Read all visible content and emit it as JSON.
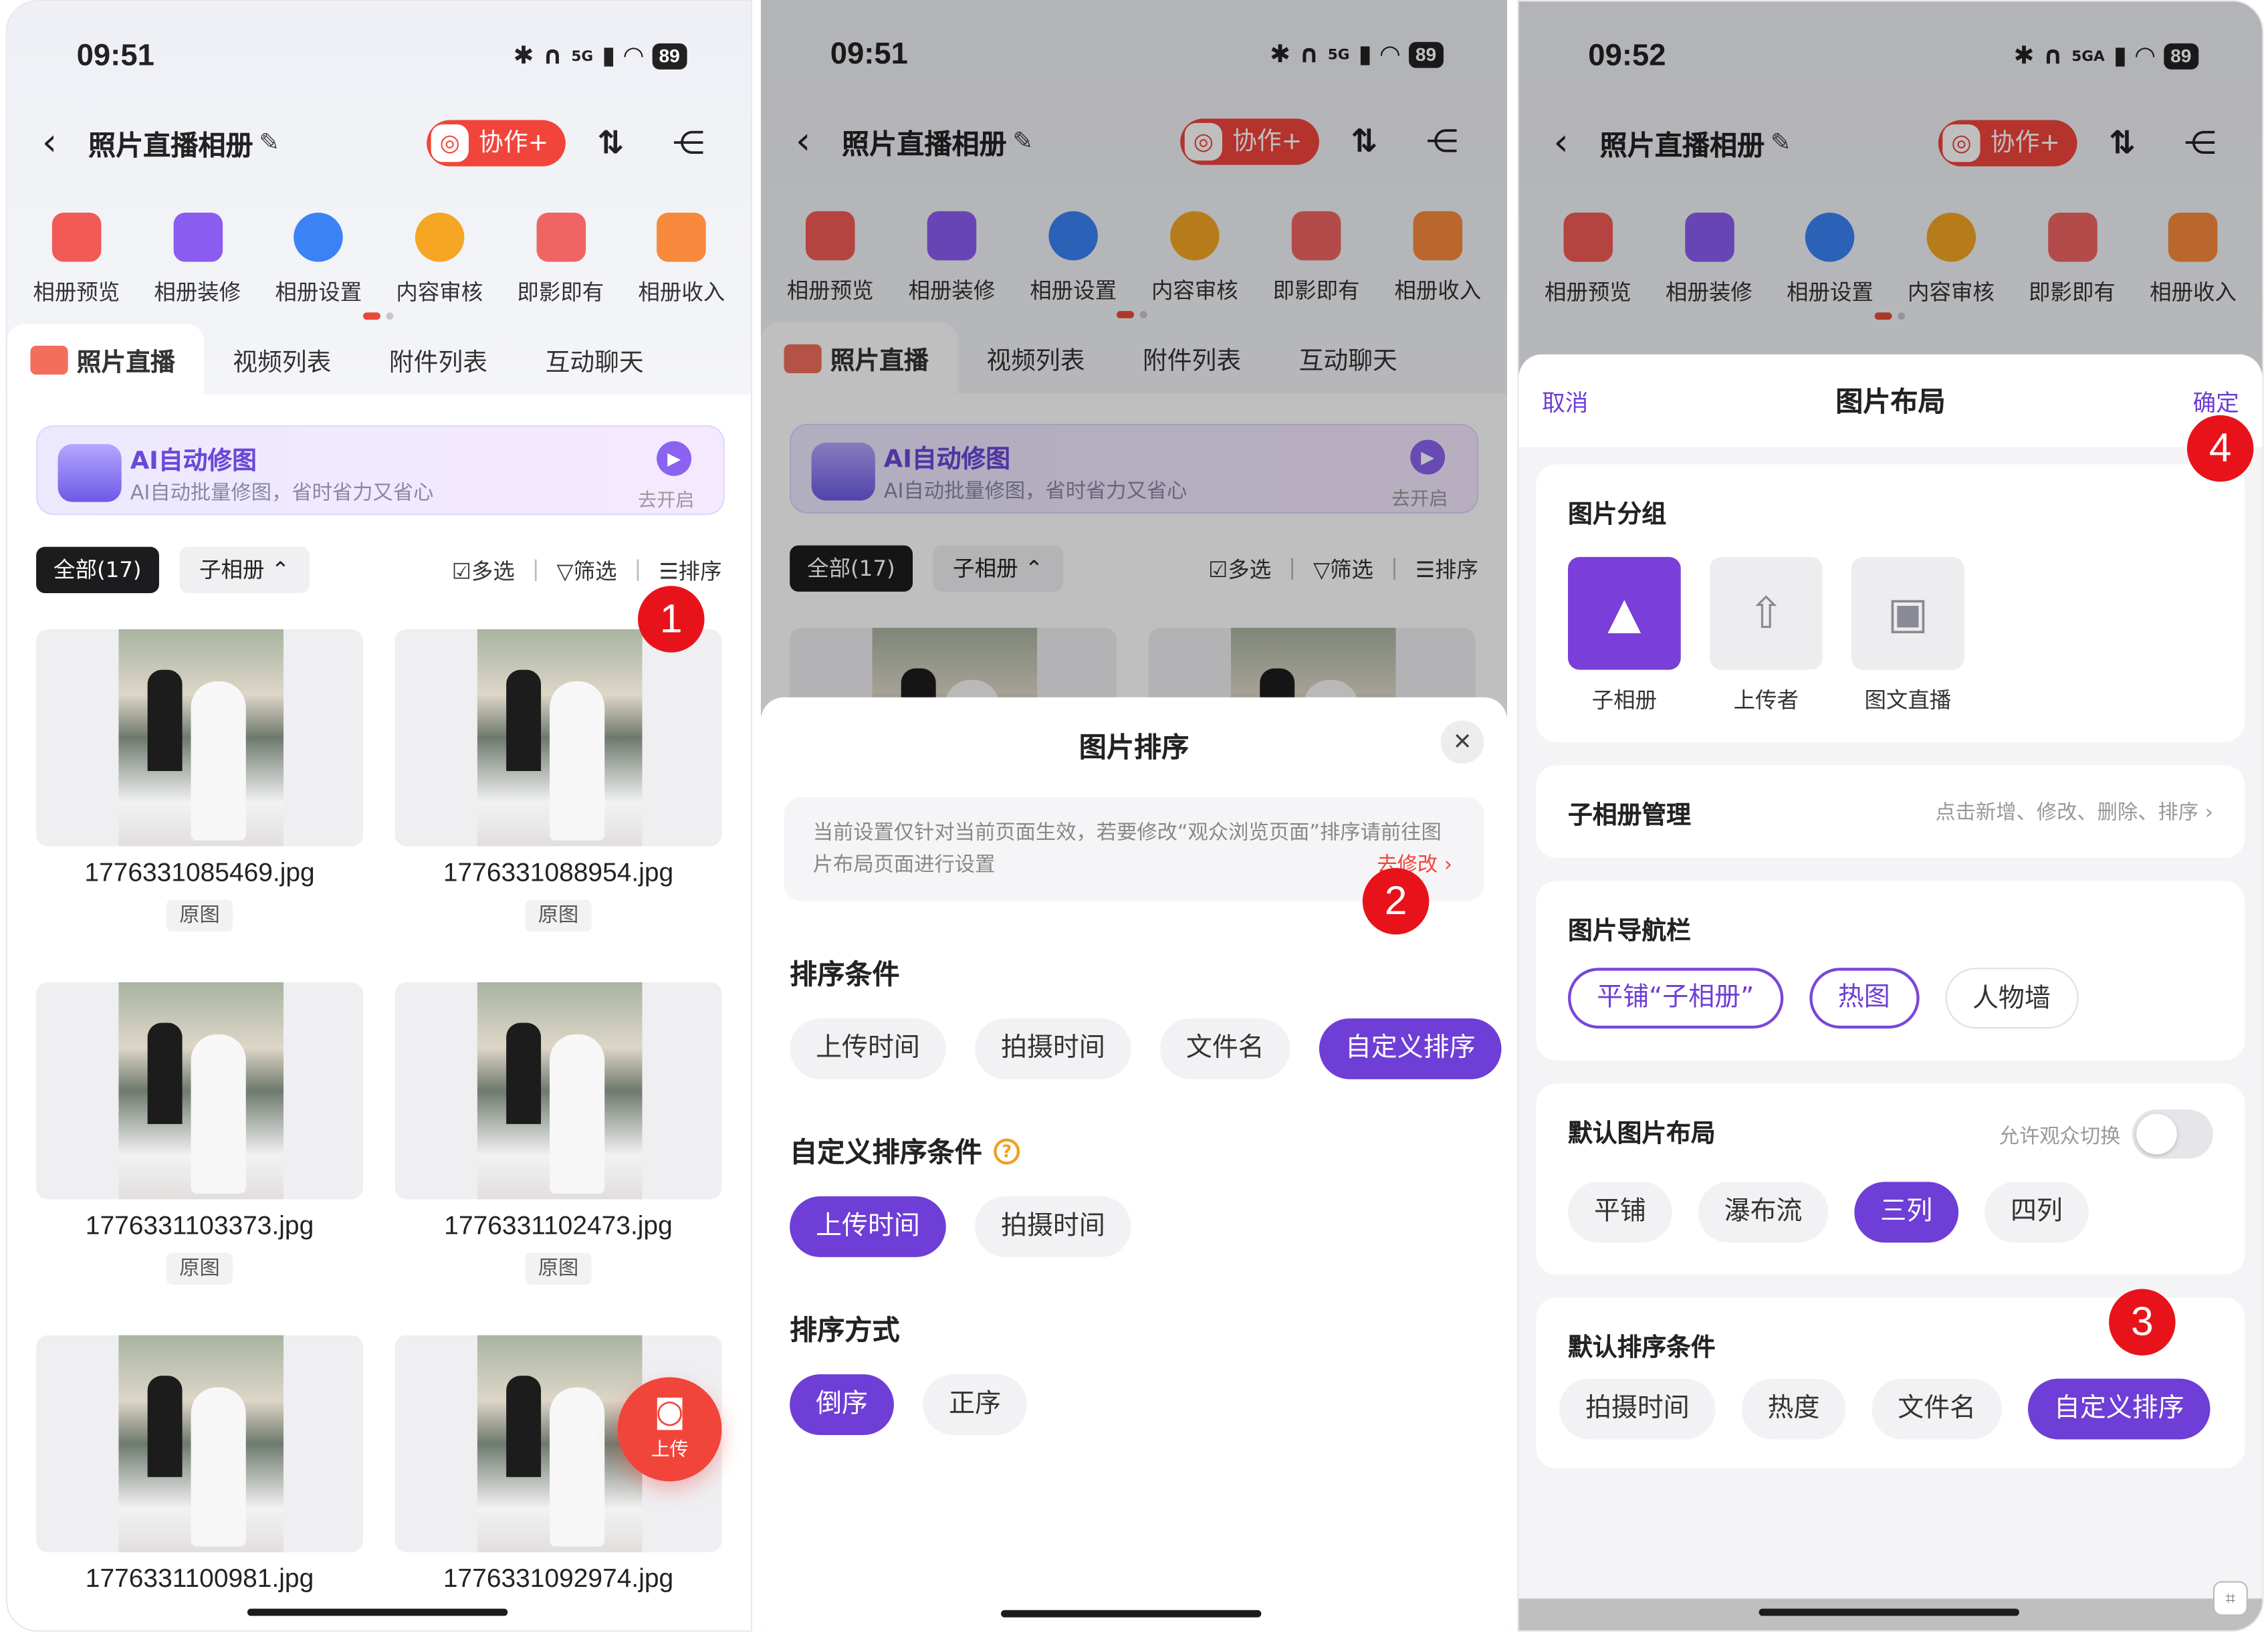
{
  "panels": {
    "p1": {
      "time": "09:51"
    },
    "p2": {
      "time": "09:51"
    },
    "p3": {
      "time": "09:52"
    }
  },
  "status_network": "5G",
  "status_network_p3": "5GA",
  "battery": "89",
  "header": {
    "title": "照片直播相册",
    "collab_label": "协作+"
  },
  "toolbar_icons": [
    {
      "label": "相册预览",
      "color": "#f25a56"
    },
    {
      "label": "相册装修",
      "color": "#8a5cf0"
    },
    {
      "label": "相册设置",
      "color": "#3b82f6"
    },
    {
      "label": "内容审核",
      "color": "#f5a623"
    },
    {
      "label": "即影即有",
      "color": "#f06464"
    },
    {
      "label": "相册收入",
      "color": "#f78a3c"
    }
  ],
  "tabs": [
    "照片直播",
    "视频列表",
    "附件列表",
    "互动聊天"
  ],
  "ai_banner": {
    "title": "AI自动修图",
    "subtitle": "AI自动批量修图，省时省力又省心",
    "action": "去开启"
  },
  "filter": {
    "all_label": "全部(17)",
    "sub_album": "子相册",
    "multi": "多选",
    "filter": "筛选",
    "sort": "排序"
  },
  "photos": [
    {
      "name": "1776331085469.jpg",
      "tag": "原图"
    },
    {
      "name": "1776331088954.jpg",
      "tag": "原图"
    },
    {
      "name": "1776331103373.jpg",
      "tag": "原图"
    },
    {
      "name": "1776331102473.jpg",
      "tag": "原图"
    },
    {
      "name": "1776331100981.jpg"
    },
    {
      "name": "1776331092974.jpg"
    }
  ],
  "upload_label": "上传",
  "markers": [
    "1",
    "2",
    "3",
    "4"
  ],
  "sort_sheet": {
    "title": "图片排序",
    "notice": "当前设置仅针对当前页面生效，若要修改“观众浏览页面”排序请前往图片布局页面进行设置",
    "notice_link": "去修改",
    "condition_title": "排序条件",
    "conditions": [
      "上传时间",
      "拍摄时间",
      "文件名",
      "自定义排序"
    ],
    "custom_title": "自定义排序条件",
    "custom_conditions": [
      "上传时间",
      "拍摄时间"
    ],
    "order_title": "排序方式",
    "orders": [
      "倒序",
      "正序"
    ]
  },
  "layout_sheet": {
    "cancel": "取消",
    "title": "图片布局",
    "confirm": "确定",
    "group_title": "图片分组",
    "groups": [
      "子相册",
      "上传者",
      "图文直播"
    ],
    "sub_mgmt_title": "子相册管理",
    "sub_mgmt_link": "点击新增、修改、删除、排序",
    "nav_title": "图片导航栏",
    "nav_items": [
      "平铺“子相册”",
      "热图",
      "人物墙"
    ],
    "default_layout_title": "默认图片布局",
    "allow_switch": "允许观众切换",
    "layouts": [
      "平铺",
      "瀑布流",
      "三列",
      "四列"
    ],
    "default_sort_title": "默认排序条件",
    "sorts": [
      "拍摄时间",
      "热度",
      "文件名",
      "自定义排序"
    ]
  }
}
